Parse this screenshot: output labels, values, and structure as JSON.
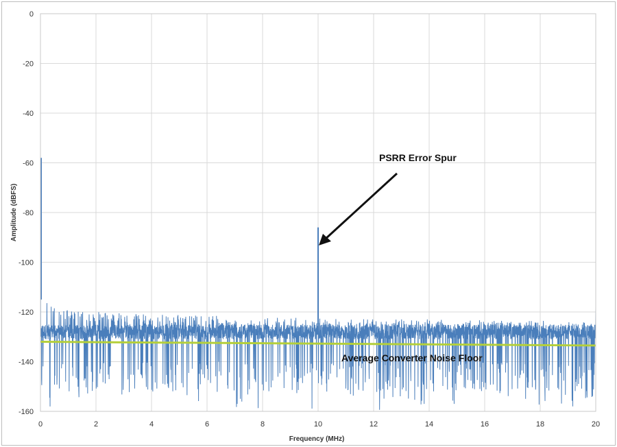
{
  "chart_data": {
    "type": "line",
    "title": "",
    "xlabel": "Frequency (MHz)",
    "ylabel": "Amplitude (dBFS)",
    "xlim": [
      0,
      20
    ],
    "ylim": [
      -160,
      0
    ],
    "x_ticks": [
      "0",
      "2",
      "4",
      "6",
      "8",
      "10",
      "12",
      "14",
      "16",
      "18",
      "20"
    ],
    "y_ticks": [
      "0",
      "-20",
      "-40",
      "-60",
      "-80",
      "-100",
      "-120",
      "-140",
      "-160"
    ],
    "grid": true,
    "colors": {
      "spectrum": "#4a7ebb",
      "noise_floor": "#b4cf3a",
      "grid": "#d9d9d9"
    },
    "series": [
      {
        "role": "spectrum",
        "noise_band_dBFS": [
          -148,
          -122
        ],
        "noise_peak_envelope": [
          [
            0,
            -110
          ],
          [
            0.05,
            -106
          ],
          [
            0.15,
            -112
          ],
          [
            0.3,
            -116
          ],
          [
            0.5,
            -118
          ],
          [
            1.0,
            -119
          ],
          [
            2.0,
            -120
          ],
          [
            4.0,
            -121
          ],
          [
            8.0,
            -122
          ],
          [
            12.0,
            -123
          ],
          [
            16.0,
            -123
          ],
          [
            20.0,
            -124
          ]
        ],
        "dc_peak": {
          "x": 0,
          "y": -58
        },
        "spur": {
          "x": 10,
          "y": -86
        },
        "end_peak": {
          "x": 20,
          "y": -118
        },
        "min_dips_dBFS": -160
      },
      {
        "role": "noise_floor",
        "x": [
          0,
          20
        ],
        "y": [
          -132,
          -133.5
        ]
      }
    ],
    "annotations": [
      {
        "label": "PSRR Error Spur",
        "points_to": {
          "x": 10,
          "y": -88
        }
      },
      {
        "label": "Average Converter Noise Floor"
      }
    ]
  }
}
